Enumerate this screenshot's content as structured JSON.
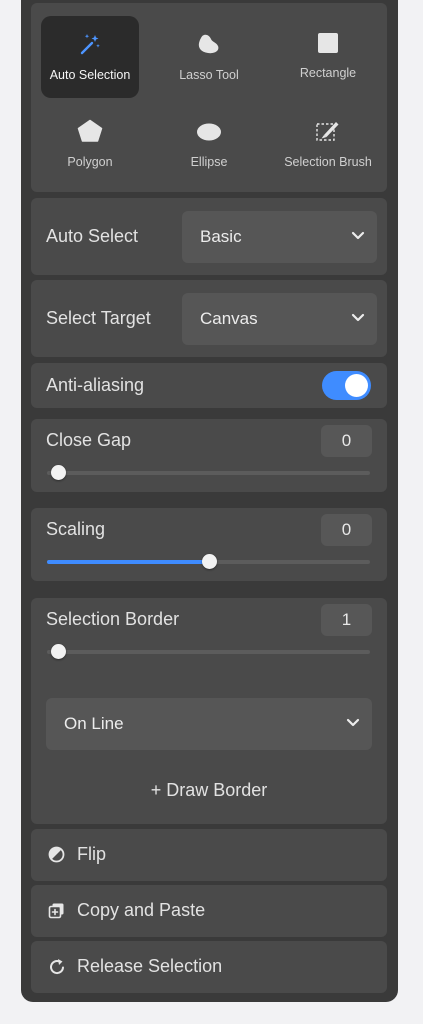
{
  "tools": [
    {
      "label": "Auto Selection",
      "icon": "magic-wand-icon",
      "active": true
    },
    {
      "label": "Lasso Tool",
      "icon": "lasso-icon",
      "active": false
    },
    {
      "label": "Rectangle",
      "icon": "rectangle-icon",
      "active": false
    },
    {
      "label": "Polygon",
      "icon": "polygon-icon",
      "active": false
    },
    {
      "label": "Ellipse",
      "icon": "ellipse-icon",
      "active": false
    },
    {
      "label": "Selection Brush",
      "icon": "selection-brush-icon",
      "active": false
    }
  ],
  "auto_select": {
    "label": "Auto Select",
    "value": "Basic"
  },
  "select_target": {
    "label": "Select Target",
    "value": "Canvas"
  },
  "anti_aliasing": {
    "label": "Anti-aliasing",
    "enabled": true
  },
  "close_gap": {
    "label": "Close Gap",
    "value": "0",
    "level": 0
  },
  "scaling": {
    "label": "Scaling",
    "value": "0",
    "level": 0.5
  },
  "selection_border": {
    "label": "Selection Border",
    "value": "1",
    "level": 0,
    "position": "On Line",
    "draw_label": "+ Draw Border"
  },
  "actions": {
    "flip": "Flip",
    "copy_paste": "Copy and Paste",
    "release": "Release Selection"
  },
  "colors": {
    "accent": "#3f8cff",
    "panel": "#3a3a3a",
    "card": "#4a4a4a"
  }
}
